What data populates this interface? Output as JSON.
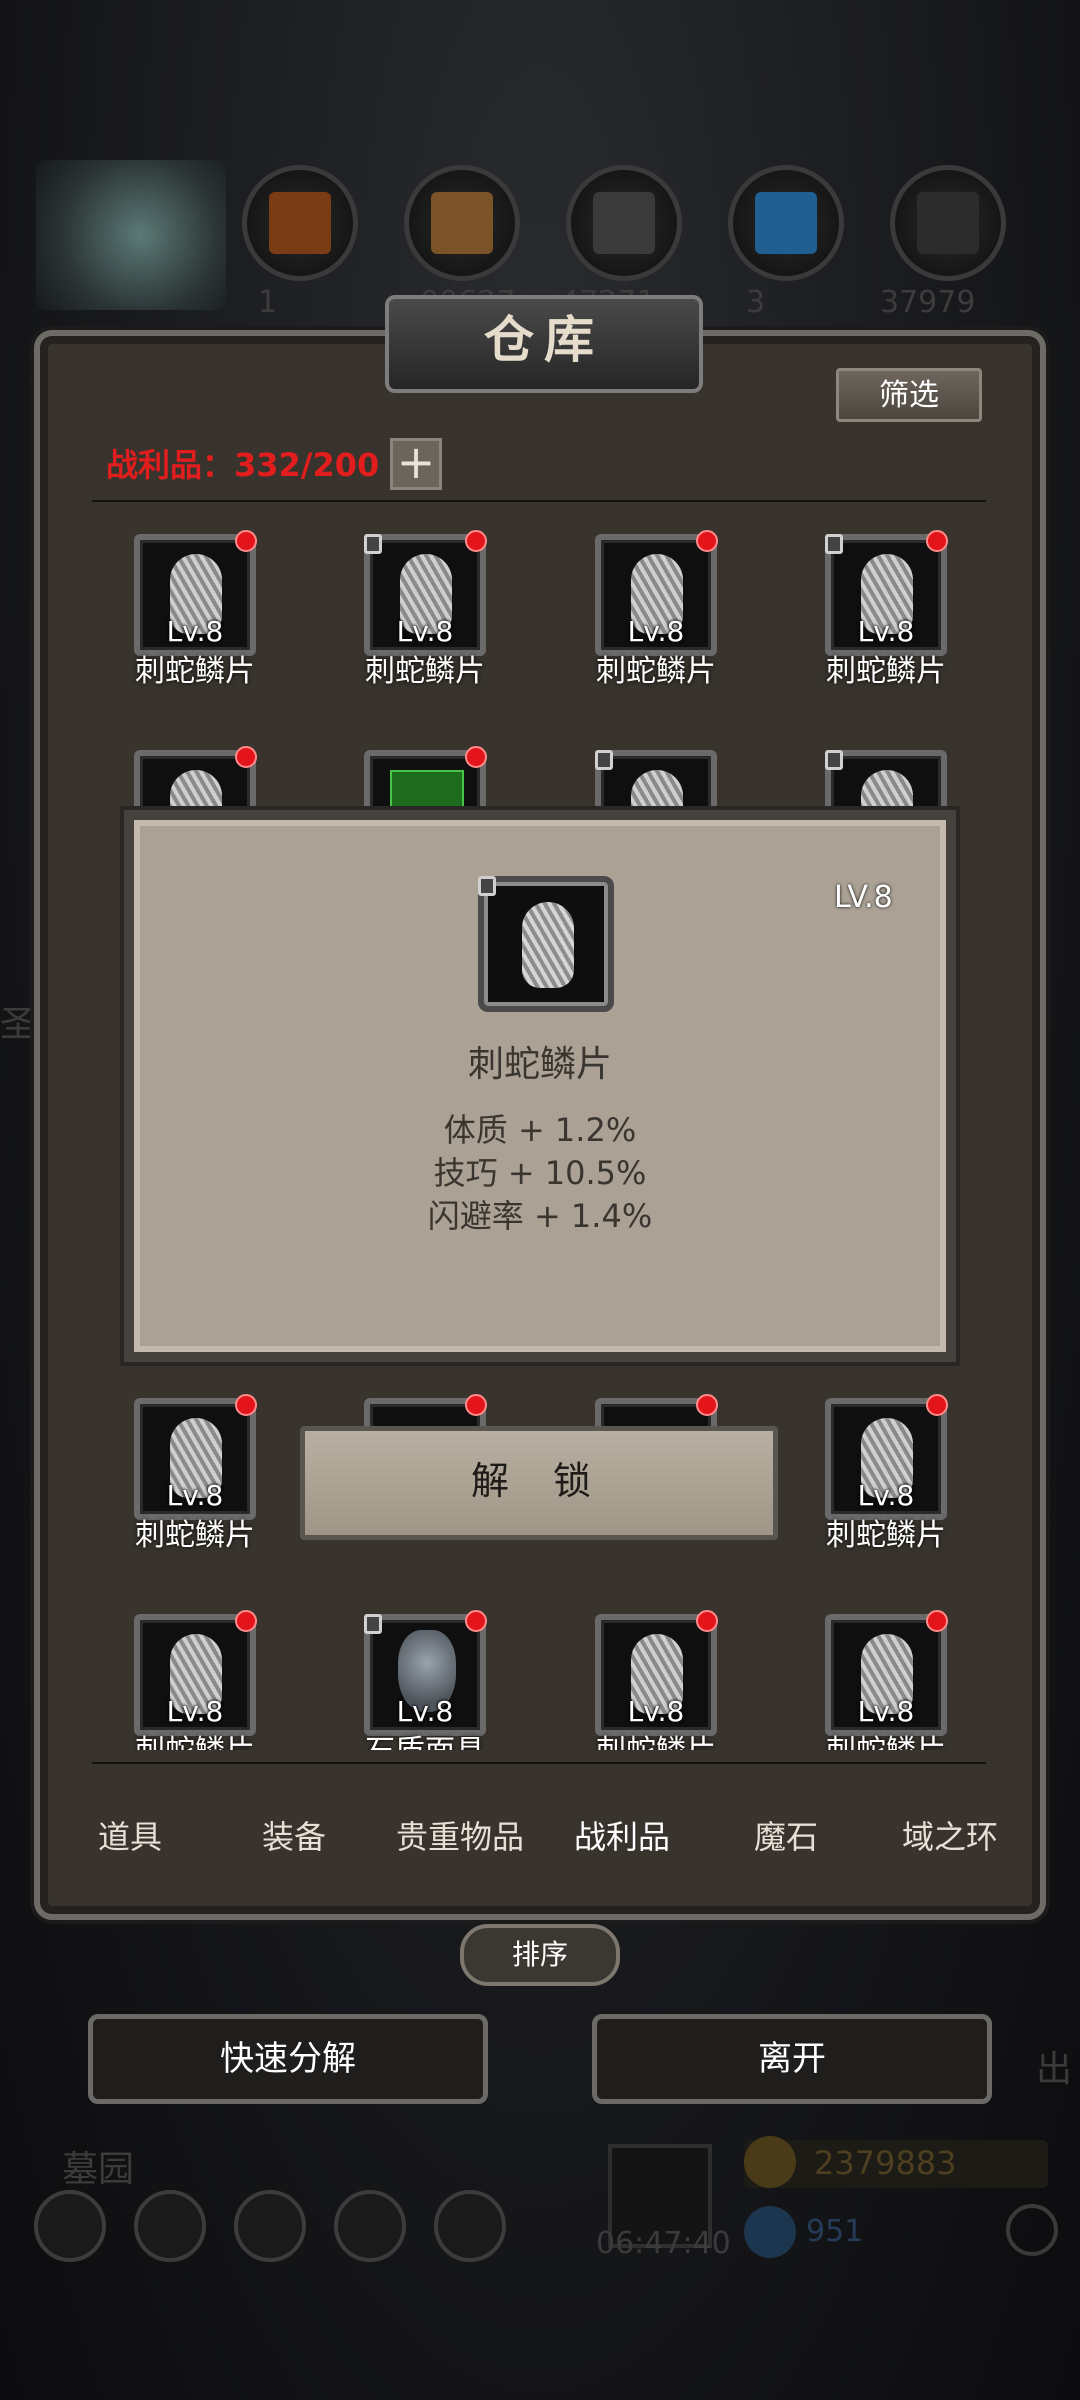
{
  "hud": {
    "resource_numbers": [
      "1",
      "00627",
      "47271",
      "",
      "3",
      "3",
      "37979"
    ],
    "gold": "2379883",
    "gems": "951",
    "timer": "06:47:40",
    "area_label": "墓园",
    "side_left": "圣",
    "side_right": "出"
  },
  "window": {
    "title": "仓库",
    "filter_label": "筛选",
    "loot_count": "战利品：332/200",
    "plus_label": "+"
  },
  "slots": [
    {
      "lv": "Lv.8",
      "name": "刺蛇鳞片"
    },
    {
      "lv": "Lv.8",
      "name": "刺蛇鳞片"
    },
    {
      "lv": "Lv.8",
      "name": "刺蛇鳞片"
    },
    {
      "lv": "Lv.8",
      "name": "刺蛇鳞片"
    },
    {
      "lv": "Lv.8",
      "name": "刺蛇鳞片"
    },
    {
      "lv": "Lv.8",
      "name": "刺蛇鳞片"
    },
    {
      "lv": "Lv.8",
      "name": "刺蛇鳞片"
    },
    {
      "lv": "Lv.8",
      "name": "石质面具"
    },
    {
      "lv": "Lv.8",
      "name": "刺蛇鳞片"
    },
    {
      "lv": "Lv.8",
      "name": "刺蛇鳞片"
    }
  ],
  "popup": {
    "lv": "LV.8",
    "name": "刺蛇鳞片",
    "stats": [
      "体质 + 1.2%",
      "技巧 + 10.5%",
      "闪避率 + 1.4%"
    ],
    "unlock_label": "解 锁"
  },
  "tabs": [
    {
      "label": "道具"
    },
    {
      "label": "装备"
    },
    {
      "label": "贵重物品"
    },
    {
      "label": "战利品",
      "active": true
    },
    {
      "label": "魔石"
    },
    {
      "label": "域之环"
    }
  ],
  "buttons": {
    "sort": "排序",
    "quick_decompose": "快速分解",
    "leave": "离开"
  },
  "colors": {
    "loot_count": "#e21d1d",
    "badge": "#e3151a",
    "panel": "#38332d",
    "popup": "#aba295"
  }
}
